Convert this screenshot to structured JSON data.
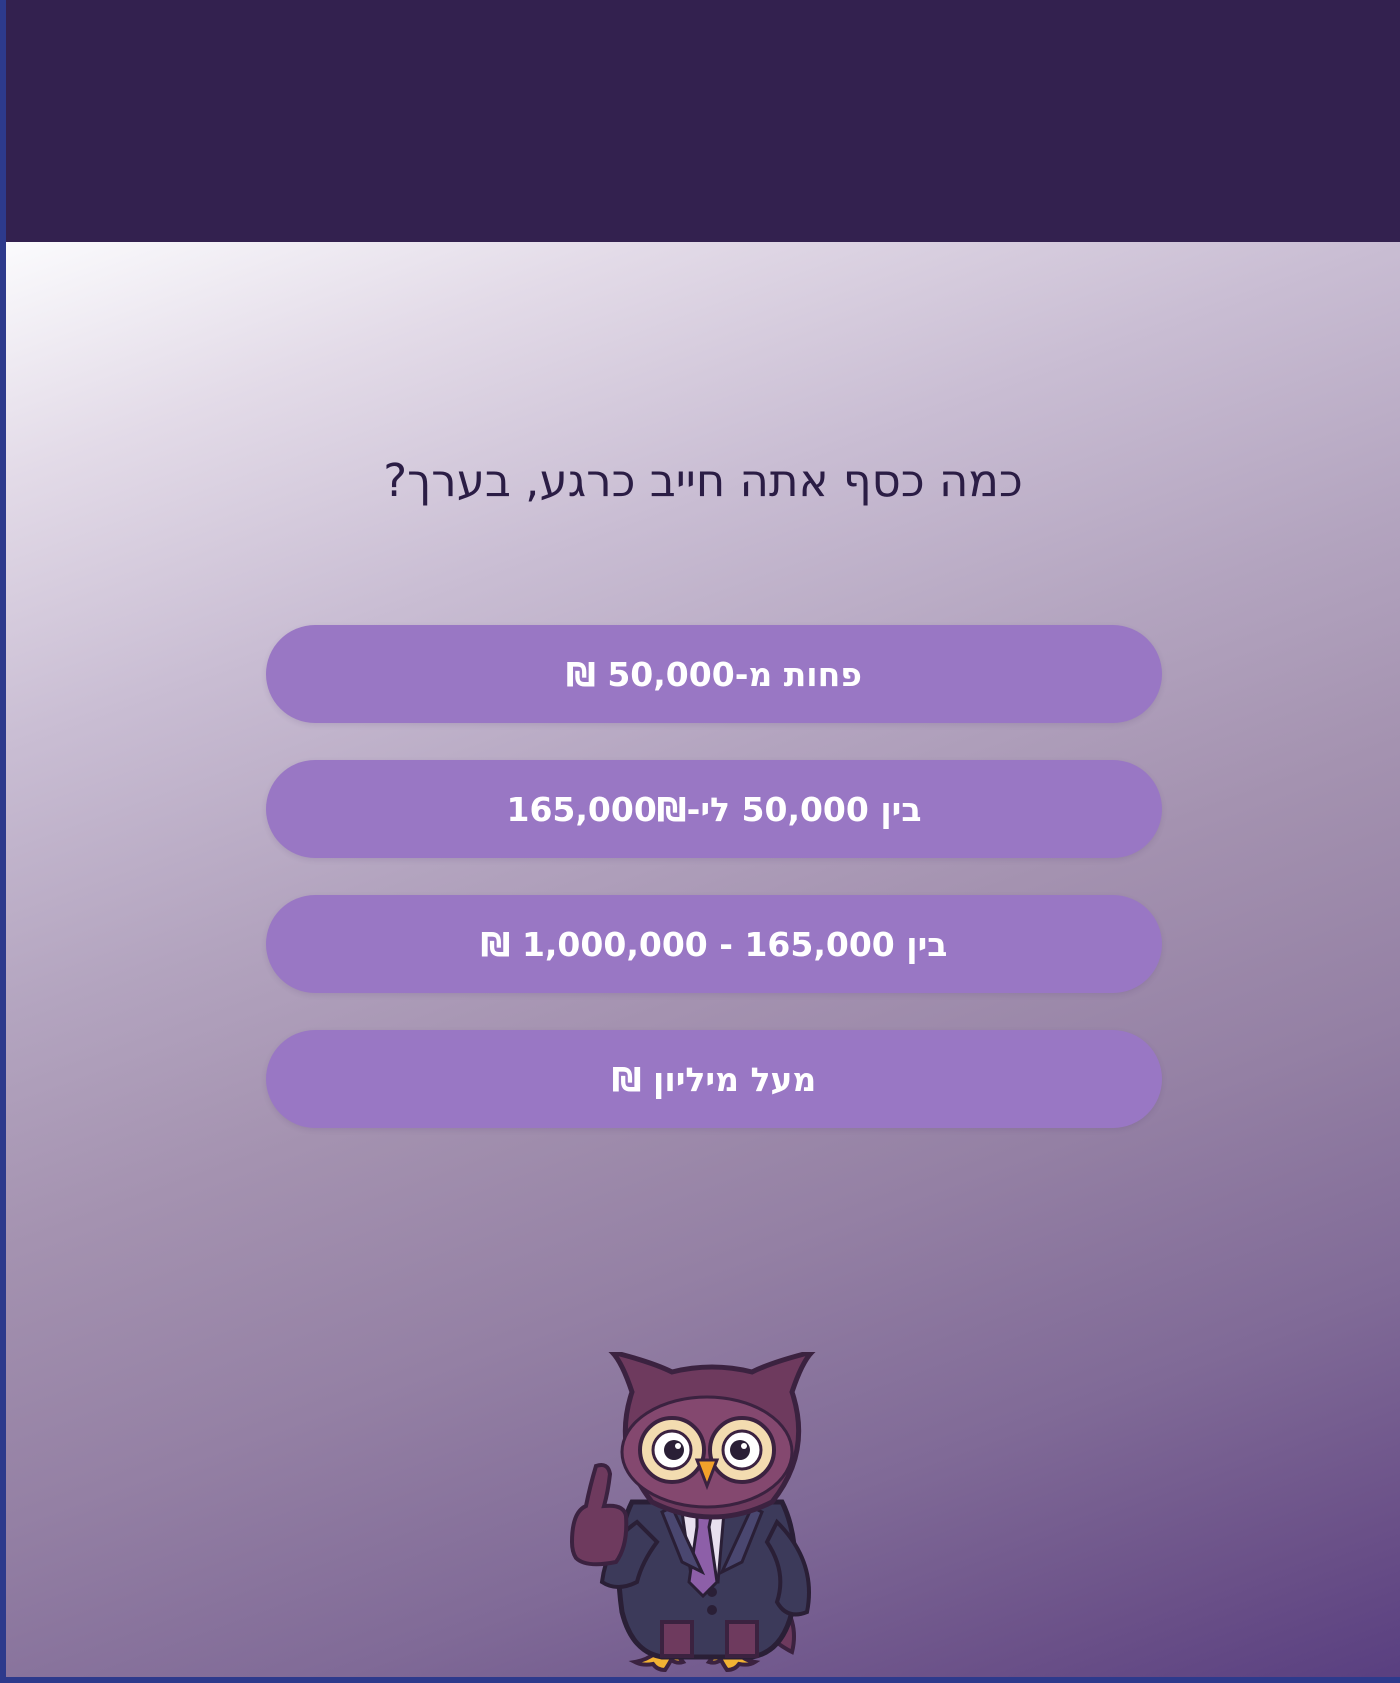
{
  "quiz": {
    "question": "כמה כסף אתה חייב כרגע, בערך?",
    "options": [
      {
        "label": "פחות מ-50,000 ₪"
      },
      {
        "label": "בין 50,000 לי-165,000₪"
      },
      {
        "label": "בין 165,000 - 1,000,000 ₪"
      },
      {
        "label": "מעל מיליון ₪"
      }
    ]
  },
  "colors": {
    "header_bg": "#33214f",
    "button_bg": "#9977c4",
    "button_text": "#ffffff",
    "question_text": "#2b1d45"
  },
  "mascot": {
    "icon": "owl-thumbs-up-icon"
  }
}
